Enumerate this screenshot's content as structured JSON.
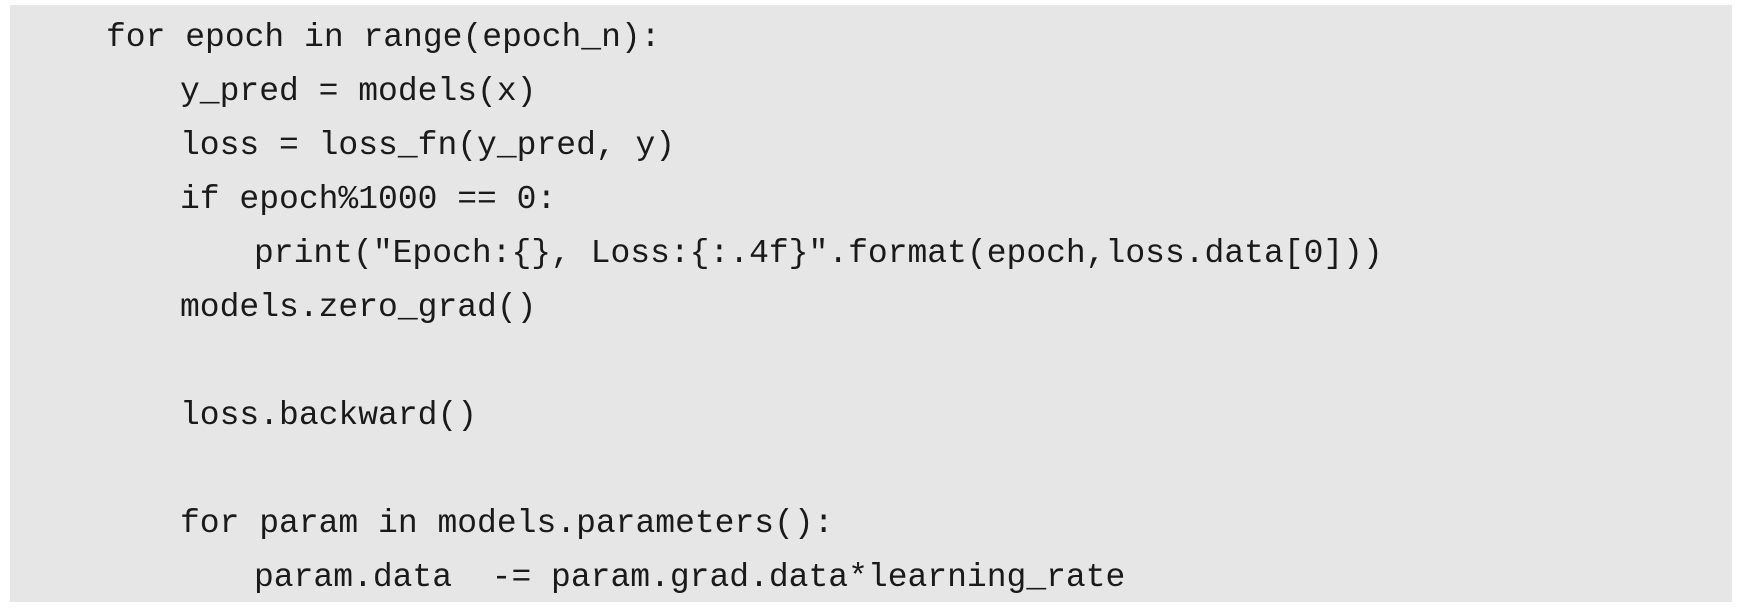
{
  "code_block": {
    "lines": [
      "for epoch in range(epoch_n):",
      "y_pred = models(x)",
      "loss = loss_fn(y_pred, y)",
      "if epoch%1000 == 0:",
      "print(\"Epoch:{}, Loss:{:.4f}\".format(epoch,loss.data[0]))",
      "models.zero_grad()",
      "",
      "loss.backward()",
      "",
      "for param in models.parameters():",
      "param.data  -= param.grad.data*learning_rate"
    ]
  },
  "colors": {
    "background": "#e6e6e6",
    "text": "#1a1a1a"
  }
}
